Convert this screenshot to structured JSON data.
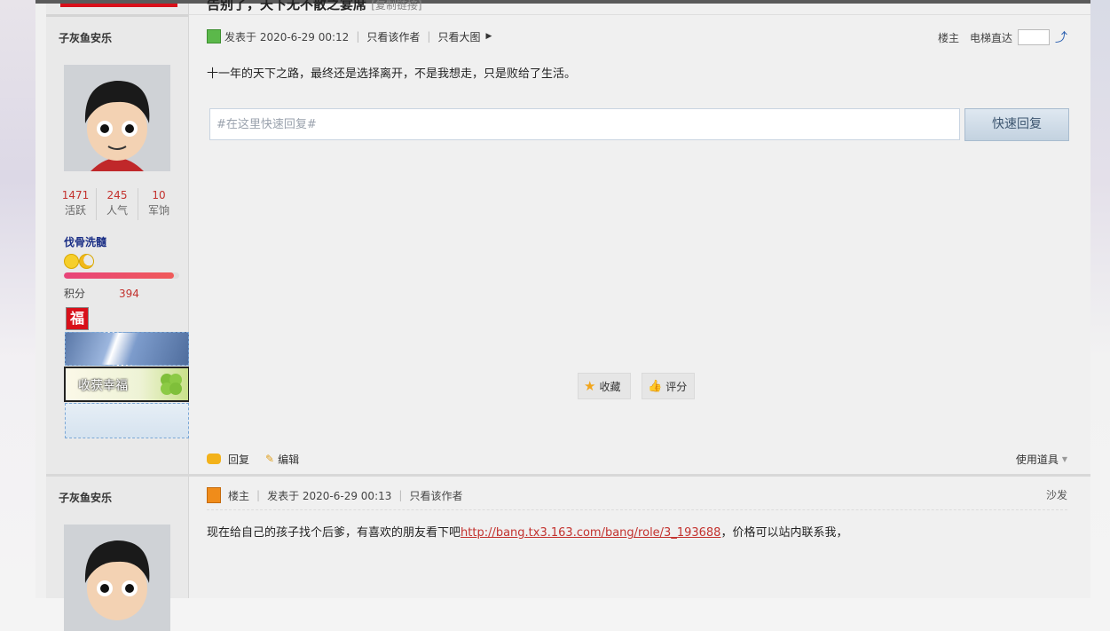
{
  "thread": {
    "title_partial": "告别了，天下无不散之宴席",
    "copy_link": "[复制链接]"
  },
  "post1": {
    "author": "子灰鱼安乐",
    "stats": [
      {
        "value": "1471",
        "label": "活跃"
      },
      {
        "value": "245",
        "label": "人气"
      },
      {
        "value": "10",
        "label": "军饷"
      }
    ],
    "rank": "伐骨洗髓",
    "score_label": "积分",
    "score_value": "394",
    "progress_fraction": 0.95,
    "medal_text": "福",
    "banner_text": "收获幸福",
    "posted": "发表于 2020-6-29 00:12",
    "only_author": "只看该作者",
    "big_image": "只看大图",
    "floor_label": "楼主",
    "elevator": "电梯直达",
    "content": "十一年的天下之路，最终还是选择离开，不是我想走，只是败给了生活。",
    "quick_reply_placeholder": "#在这里快速回复#",
    "quick_reply_button": "快速回复",
    "favorite": "收藏",
    "rate": "评分",
    "reply": "回复",
    "edit": "编辑",
    "use_tools": "使用道具"
  },
  "post2": {
    "author": "子灰鱼安乐",
    "floor_owner": "楼主",
    "posted": "发表于 2020-6-29 00:13",
    "only_author": "只看该作者",
    "sofa": "沙发",
    "content_before": "现在给自己的孩子找个后爹，有喜欢的朋友看下吧",
    "link": "http://bang.tx3.163.com/bang/role/3_193688",
    "content_after": "，价格可以站内联系我，"
  },
  "colors": {
    "accent_red": "#c3322e",
    "rank_blue": "#1b2f86",
    "link_red": "#c3322e"
  }
}
